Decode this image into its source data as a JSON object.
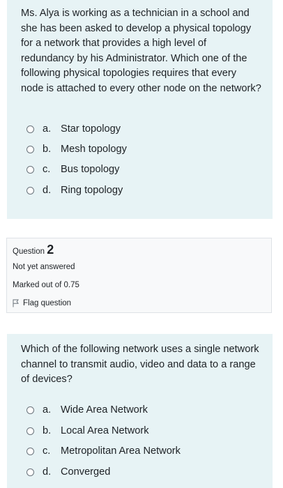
{
  "q1": {
    "text": "Ms. Alya is working as a technician in a school and she has been asked to develop a physical topology for a network that provides a high level of redundancy by his Administrator. Which one of the following physical topologies requires that every node is attached to every other node on the network?",
    "options": [
      {
        "letter": "a.",
        "label": "Star topology"
      },
      {
        "letter": "b.",
        "label": "Mesh topology"
      },
      {
        "letter": "c.",
        "label": "Bus topology"
      },
      {
        "letter": "d.",
        "label": "Ring topology"
      }
    ]
  },
  "q2_info": {
    "question_label": "Question",
    "question_number": "2",
    "status": "Not yet answered",
    "marks": "Marked out of 0.75",
    "flag_label": "Flag question",
    "flag_icon": "flag-outline-icon"
  },
  "q2": {
    "text": "Which of the following network uses a single network channel to transmit audio, video and data to a range of devices?",
    "options": [
      {
        "letter": "a.",
        "label": "Wide Area Network"
      },
      {
        "letter": "b.",
        "label": "Local Area Network"
      },
      {
        "letter": "c.",
        "label": "Metropolitan Area Network"
      },
      {
        "letter": "d.",
        "label": "Converged"
      }
    ]
  },
  "colors": {
    "question_bg": "#e7f3f5",
    "info_bg": "#f8f9fa",
    "text": "#1d2125"
  }
}
